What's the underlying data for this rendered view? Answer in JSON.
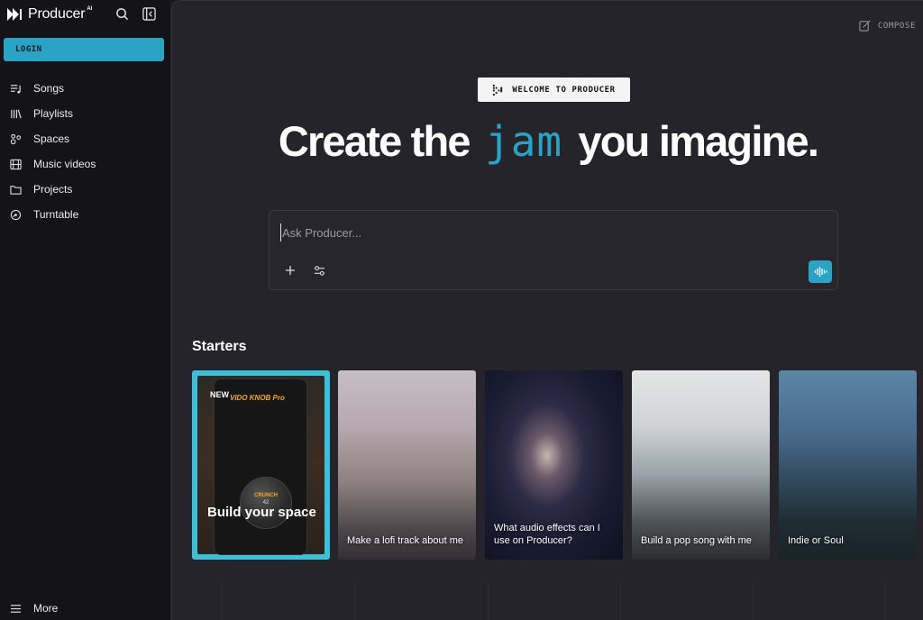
{
  "brand": {
    "name": "Producer",
    "superscript": "AI"
  },
  "sidebar": {
    "login_label": "LOGIN",
    "items": [
      {
        "label": "Songs",
        "icon": "songs-icon"
      },
      {
        "label": "Playlists",
        "icon": "playlists-icon"
      },
      {
        "label": "Spaces",
        "icon": "spaces-icon"
      },
      {
        "label": "Music videos",
        "icon": "film-icon"
      },
      {
        "label": "Projects",
        "icon": "folder-icon"
      },
      {
        "label": "Turntable",
        "icon": "turntable-icon"
      }
    ],
    "more_label": "More"
  },
  "header": {
    "compose_label": "COMPOSE"
  },
  "hero": {
    "welcome_label": "WELCOME TO PRODUCER",
    "headline_before": "Create the",
    "headline_highlight": "jam",
    "headline_after": "you imagine."
  },
  "ask": {
    "placeholder": "Ask Producer..."
  },
  "starters": {
    "title": "Starters",
    "cards": [
      {
        "caption": "Build your space",
        "badge": "NEW",
        "knob_title": "VIDO KNOB Pro",
        "knob_label": "CRUNCH",
        "knob_value": "42"
      },
      {
        "caption": "Make a lofi track about me"
      },
      {
        "caption": "What audio effects can I use on Producer?"
      },
      {
        "caption": "Build a pop song with me"
      },
      {
        "caption": "Indie or Soul"
      }
    ]
  },
  "colors": {
    "accent": "#2aa3c4",
    "background": "#25242a",
    "sidebar": "#141318"
  }
}
